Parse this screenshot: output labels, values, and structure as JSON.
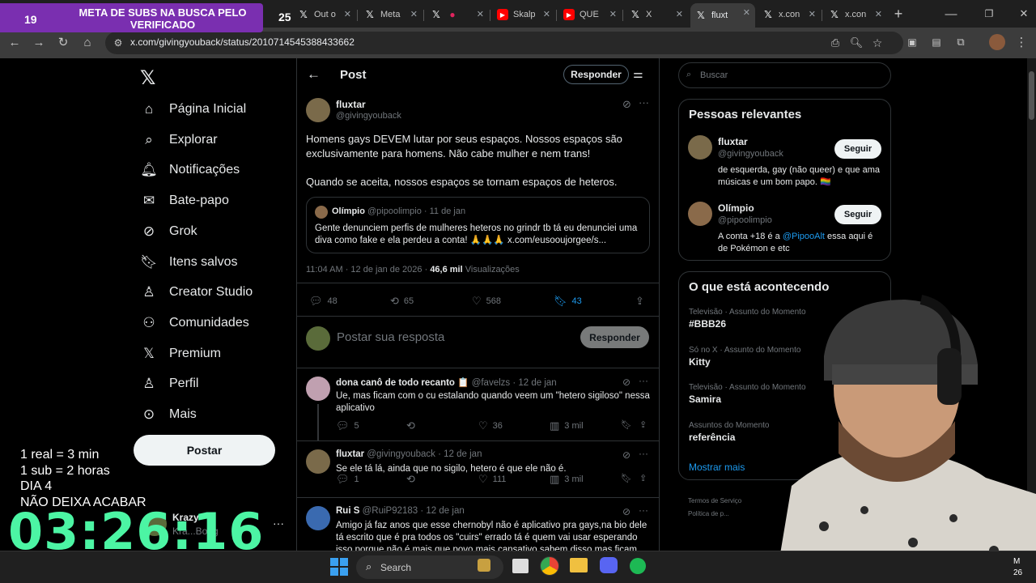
{
  "browser": {
    "tabs": [
      {
        "label": "Out o",
        "icon": "x-icon"
      },
      {
        "label": "Meta",
        "icon": "x-icon"
      },
      {
        "label": "",
        "icon": "x-icon"
      },
      {
        "label": "Skalp",
        "icon": "youtube-icon"
      },
      {
        "label": "QUE",
        "icon": "youtube-icon"
      },
      {
        "label": "X",
        "icon": "x-icon"
      },
      {
        "label": "fluxt",
        "icon": "x-icon",
        "active": true
      },
      {
        "label": "x.con",
        "icon": "x-icon"
      },
      {
        "label": "x.con",
        "icon": "x-icon"
      }
    ],
    "url": "x.com/givingyouback/status/2010714545388433662"
  },
  "banner": {
    "count_left": "19",
    "title": "META DE SUBS NA BUSCA PELO VERIFICADO",
    "count_right": "25"
  },
  "nav": {
    "items": [
      {
        "label": "Página Inicial",
        "icon": "home-icon"
      },
      {
        "label": "Explorar",
        "icon": "search-icon"
      },
      {
        "label": "Notificações",
        "icon": "bell-icon"
      },
      {
        "label": "Bate-papo",
        "icon": "mail-icon"
      },
      {
        "label": "Grok",
        "icon": "grok-icon"
      },
      {
        "label": "Itens salvos",
        "icon": "bookmark-icon"
      },
      {
        "label": "Creator Studio",
        "icon": "creator-icon"
      },
      {
        "label": "Comunidades",
        "icon": "communities-icon"
      },
      {
        "label": "Premium",
        "icon": "x-icon"
      },
      {
        "label": "Perfil",
        "icon": "person-icon"
      },
      {
        "label": "Mais",
        "icon": "more-icon"
      }
    ],
    "post_label": "Postar",
    "account": {
      "name": "Krazy",
      "handle": "Kra...Bong"
    }
  },
  "post": {
    "header_title": "Post",
    "reply_pill": "Responder",
    "author": {
      "name": "fluxtar",
      "handle": "@givingyouback"
    },
    "text1": "Homens gays DEVEM lutar por seus espaços. Nossos espaços são exclusivamente para homens. Não cabe mulher e nem trans!",
    "text2": "Quando se aceita, nossos espaços se tornam espaços de heteros.",
    "quote": {
      "name": "Olímpio",
      "handle": "@pipoolimpio",
      "date": "· 11 de jan",
      "text": "Gente denunciem perfis de mulheres heteros no grindr tb tá eu denunciei uma diva como fake e ela perdeu a conta! 🙏🙏🙏 x.com/eusooujorgee/s..."
    },
    "time": "11:04 AM · 12 de jan de 2026 ·",
    "views": "46,6 mil",
    "views_label": "Visualizações",
    "stats": {
      "replies": "48",
      "reposts": "65",
      "likes": "568",
      "bookmarks": "43"
    },
    "compose_placeholder": "Postar sua resposta",
    "compose_button": "Responder"
  },
  "replies": [
    {
      "name": "dona canô de todo recanto 📋",
      "handle": "@favelzs",
      "date": "· 12 de jan",
      "text": "Ue, mas ficam com o cu estalando quando veem um \"hetero sigiloso\" nessa aplicativo",
      "replies": "5",
      "likes": "36",
      "views": "3 mil"
    },
    {
      "name": "fluxtar",
      "handle": "@givingyouback",
      "date": "· 12 de jan",
      "text": "Se ele tá lá, ainda que no sigilo, hetero é que ele não é.",
      "replies": "1",
      "likes": "111",
      "views": "3 mil"
    },
    {
      "name": "Rui S",
      "handle": "@RuiP92183",
      "date": "· 12 de jan",
      "text": "Amigo já faz anos que esse chernobyl não é aplicativo pra gays,na bio dele tá escrito que é pra todos os \"cuirs\" errado tá é quem vai usar esperando isso porque não é mais que povo mais cansativo sabem disso mas ficam"
    }
  ],
  "right": {
    "search_placeholder": "Buscar",
    "relevant_title": "Pessoas relevantes",
    "people": [
      {
        "name": "fluxtar",
        "handle": "@givingyouback",
        "bio": "de esquerda, gay (não queer) e que ama músicas e um bom papo. 🏳️‍🌈",
        "button": "Seguir"
      },
      {
        "name": "Olímpio",
        "handle": "@pipoolimpio",
        "bio_pre": "A conta +18 é a ",
        "bio_link": "@PipooAlt",
        "bio_post": " essa aqui é de Pokémon e etc",
        "button": "Seguir"
      }
    ],
    "trends_title": "O que está acontecendo",
    "trends": [
      {
        "category": "Televisão · Assunto do Momento",
        "name": "#BBB26"
      },
      {
        "category": "Só no X · Assunto do Momento",
        "name": "Kitty"
      },
      {
        "category": "Televisão · Assunto do Momento",
        "name": "Samira"
      },
      {
        "category": "Assuntos do Momento",
        "name": "referência"
      }
    ],
    "show_more": "Mostrar mais",
    "footer": [
      "Termos de Serviço",
      "Política de p..."
    ]
  },
  "overlay": {
    "counters": [
      "1 real = 3 min",
      "1 sub = 2 horas",
      "DIA 4",
      "NÃO DEIXA ACABAR"
    ],
    "timer": "03:26:16"
  },
  "taskbar": {
    "search_label": "Search",
    "clock_right": "M",
    "clock_bottom": "26"
  },
  "colors": {
    "accent": "#1d9bf0",
    "banner": "#7a2fb0",
    "timer": "#4cf5a4"
  }
}
